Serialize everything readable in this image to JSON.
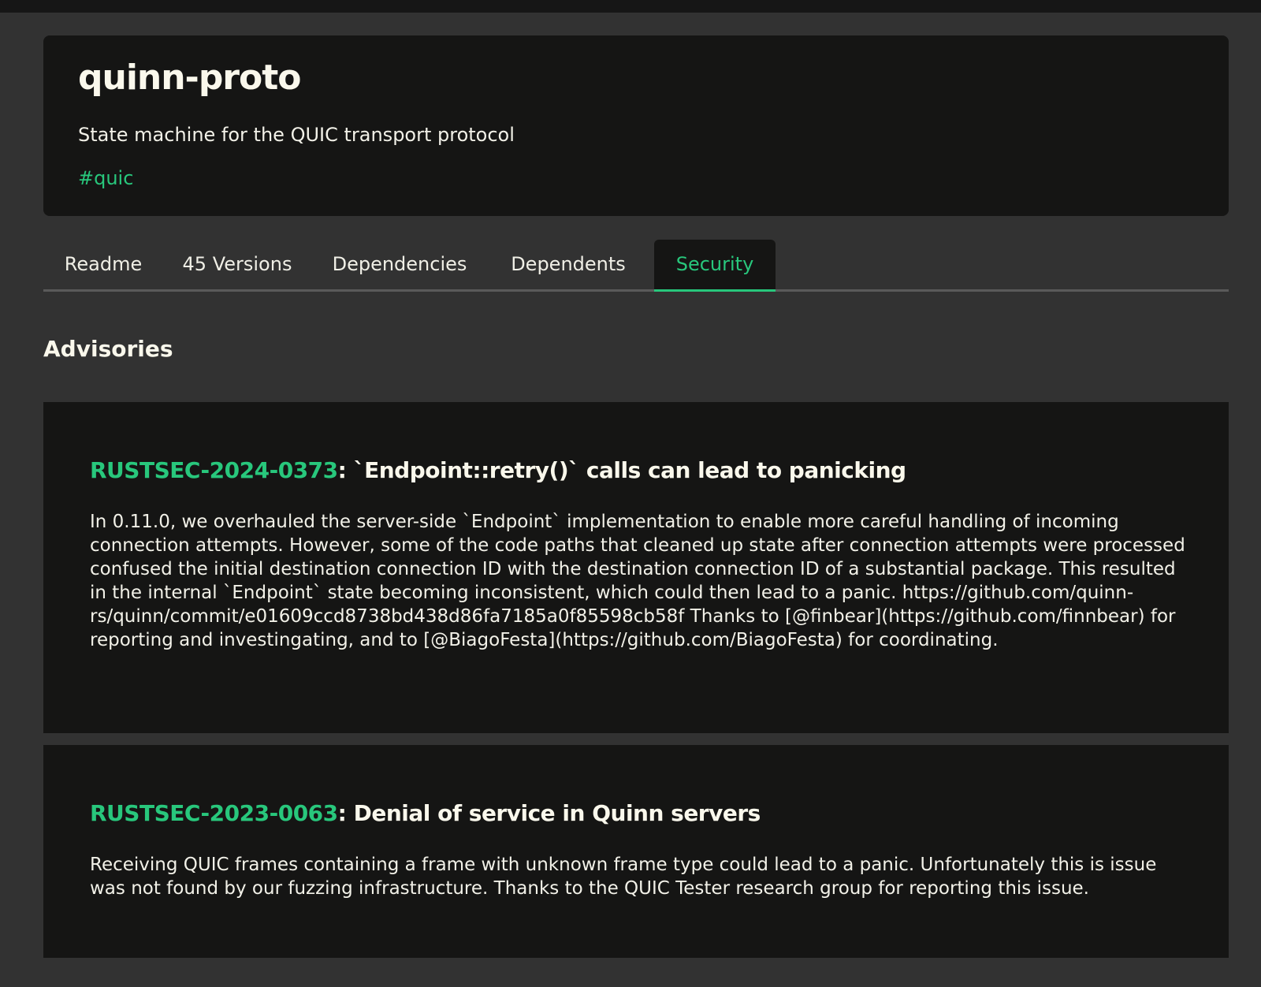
{
  "crate": {
    "name": "quinn-proto",
    "description": "State machine for the QUIC transport protocol",
    "tag": "#quic"
  },
  "tabs": [
    {
      "label": "Readme"
    },
    {
      "label": "45 Versions"
    },
    {
      "label": "Dependencies"
    },
    {
      "label": "Dependents"
    },
    {
      "label": "Security",
      "active": true
    }
  ],
  "section_title": "Advisories",
  "advisories": [
    {
      "id": "RUSTSEC-2024-0373",
      "title": ": `Endpoint::retry()` calls can lead to panicking",
      "description": "In 0.11.0, we overhauled the server-side `Endpoint` implementation to enable more careful handling of incoming connection attempts. However, some of the code paths that cleaned up state after connection attempts were processed confused the initial destination connection ID with the destination connection ID of a substantial package. This resulted in the internal `Endpoint` state becoming inconsistent, which could then lead to a panic. https://github.com/quinn-rs/quinn/commit/e01609ccd8738bd438d86fa7185a0f85598cb58f Thanks to [@finbear](https://github.com/finnbear) for reporting and investingating, and to [@BiagoFesta](https://github.com/BiagoFesta) for coordinating."
    },
    {
      "id": "RUSTSEC-2023-0063",
      "title": ": Denial of service in Quinn servers",
      "description": "Receiving QUIC frames containing a frame with unknown frame type could lead to a panic. Unfortunately this is issue was not found by our fuzzing infrastructure. Thanks to the QUIC Tester research group for reporting this issue."
    }
  ],
  "colors": {
    "background": "#323232",
    "card": "#151514",
    "accent": "#28c77c",
    "text": "#f2f1e8"
  }
}
